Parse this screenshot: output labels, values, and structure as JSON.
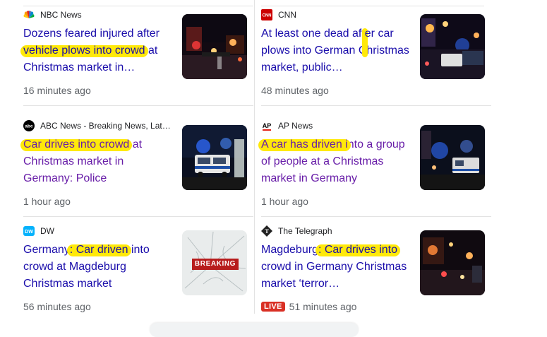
{
  "articles": [
    {
      "source": "NBC News",
      "title_pre": "Dozens feared injured after ",
      "title_hl": "vehicle plows into crowd",
      "title_post": " at Christmas market in…",
      "time": "16 minutes ago",
      "visited": false,
      "logo_icon": "nbc-peacock-icon",
      "thumb": "night-christmas-market-image"
    },
    {
      "source": "CNN",
      "title_pre": "At least one dead aft",
      "title_hl": "er car plows into German",
      "title_post": " Christmas market, public…",
      "time": "48 minutes ago",
      "visited": false,
      "logo_icon": "cnn-logo-icon",
      "thumb": "night-christmas-market-police-image"
    },
    {
      "source": "ABC News - Breaking News, Lat…",
      "title_pre": "",
      "title_hl": "Car drives into crowd",
      "title_post": " at Christmas market in Germany: Police",
      "time": "1 hour ago",
      "visited": true,
      "logo_icon": "abc-logo-icon",
      "thumb": "police-car-night-image"
    },
    {
      "source": "AP News",
      "title_pre": "",
      "title_hl": "A car has driven i",
      "title_post": "nto a group of people at a Christmas market in Germany",
      "time": "1 hour ago",
      "visited": true,
      "logo_icon": "ap-logo-icon",
      "thumb": "emergency-vehicles-night-image"
    },
    {
      "source": "DW",
      "title_pre": "Germany",
      "title_hl": ": Car driven",
      "title_post": " into crowd at Magdeburg Christmas market",
      "time": "56 minutes ago",
      "visited": false,
      "logo_icon": "dw-logo-icon",
      "thumb": "breaking-cracked-glass-image",
      "thumb_label": "BREAKING"
    },
    {
      "source": "The Telegraph",
      "title_pre": "Magdeburg",
      "title_hl": ": Car drives into",
      "title_post": " crowd in Germany Christmas market ‘terror…",
      "time": "51 minutes ago",
      "live": "LIVE",
      "visited": false,
      "logo_icon": "telegraph-logo-icon",
      "thumb": "market-night-lights-image"
    }
  ],
  "colors": {
    "link": "#1a0dab",
    "visited": "#681da8",
    "highlight": "#ffe90a",
    "meta": "#5f6368",
    "live": "#d93025"
  }
}
